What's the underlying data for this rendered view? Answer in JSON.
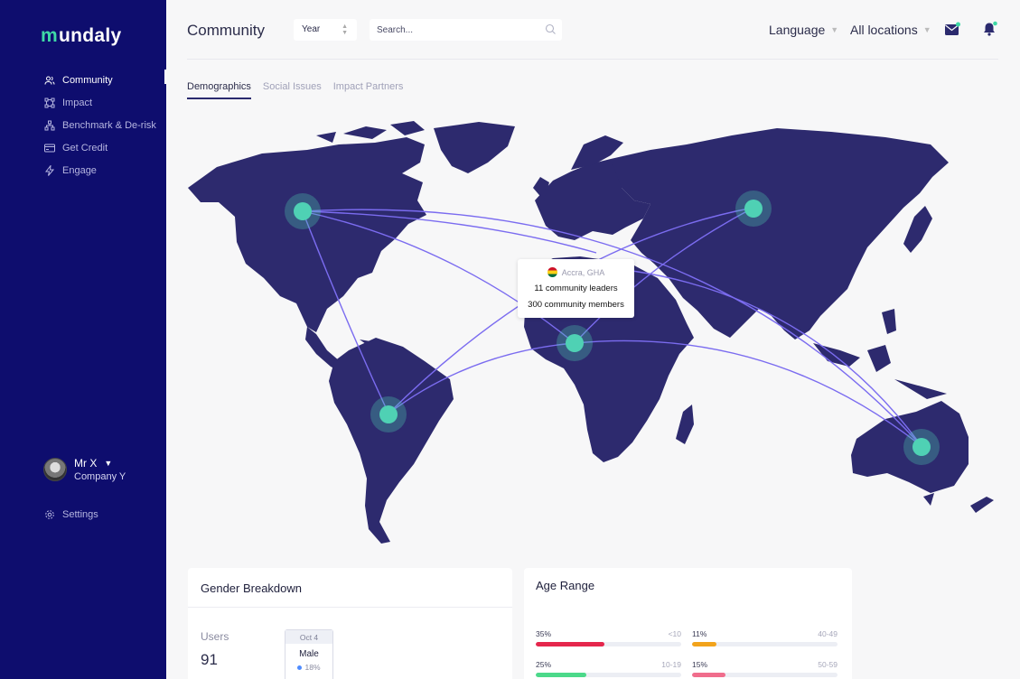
{
  "app": {
    "logo_mark": "m",
    "logo_text": "undaly"
  },
  "sidebar": {
    "items": [
      {
        "label": "Community",
        "icon": "users-icon",
        "active": true
      },
      {
        "label": "Impact",
        "icon": "nodes-icon",
        "active": false
      },
      {
        "label": "Benchmark & De-risk",
        "icon": "hierarchy-icon",
        "active": false
      },
      {
        "label": "Get Credit",
        "icon": "credit-card-icon",
        "active": false
      },
      {
        "label": "Engage",
        "icon": "bolt-icon",
        "active": false
      }
    ],
    "user": {
      "name": "Mr X",
      "company": "Company Y"
    },
    "settings_label": "Settings"
  },
  "header": {
    "title": "Community",
    "period_select": "Year",
    "search_placeholder": "Search...",
    "language_label": "Language",
    "locations_label": "All locations"
  },
  "tabs": [
    {
      "label": "Demographics",
      "active": true
    },
    {
      "label": "Social Issues",
      "active": false
    },
    {
      "label": "Impact Partners",
      "active": false
    }
  ],
  "map": {
    "tooltip": {
      "location": "Accra, GHA",
      "leaders": "11 community leaders",
      "members": "300 community members"
    }
  },
  "gender": {
    "title": "Gender Breakdown",
    "users_label": "Users",
    "users_value": "91",
    "tooltip_date": "Oct 4",
    "tooltip_label": "Male",
    "tooltip_pct": "18%"
  },
  "age": {
    "title": "Age Range",
    "rows": [
      {
        "pct": "35%",
        "range": "<10",
        "value": 0.47,
        "color": "#e5264c"
      },
      {
        "pct": "11%",
        "range": "40-49",
        "value": 0.17,
        "color": "#f2a31b"
      },
      {
        "pct": "25%",
        "range": "10-19",
        "value": 0.35,
        "color": "#4cd98a"
      },
      {
        "pct": "15%",
        "range": "50-59",
        "value": 0.23,
        "color": "#f06d8c"
      }
    ]
  },
  "colors": {
    "sidebar_bg": "#0e0d6e",
    "land": "#2d2a6e",
    "node": "#4fd1b4",
    "link": "#7b6cf0"
  }
}
